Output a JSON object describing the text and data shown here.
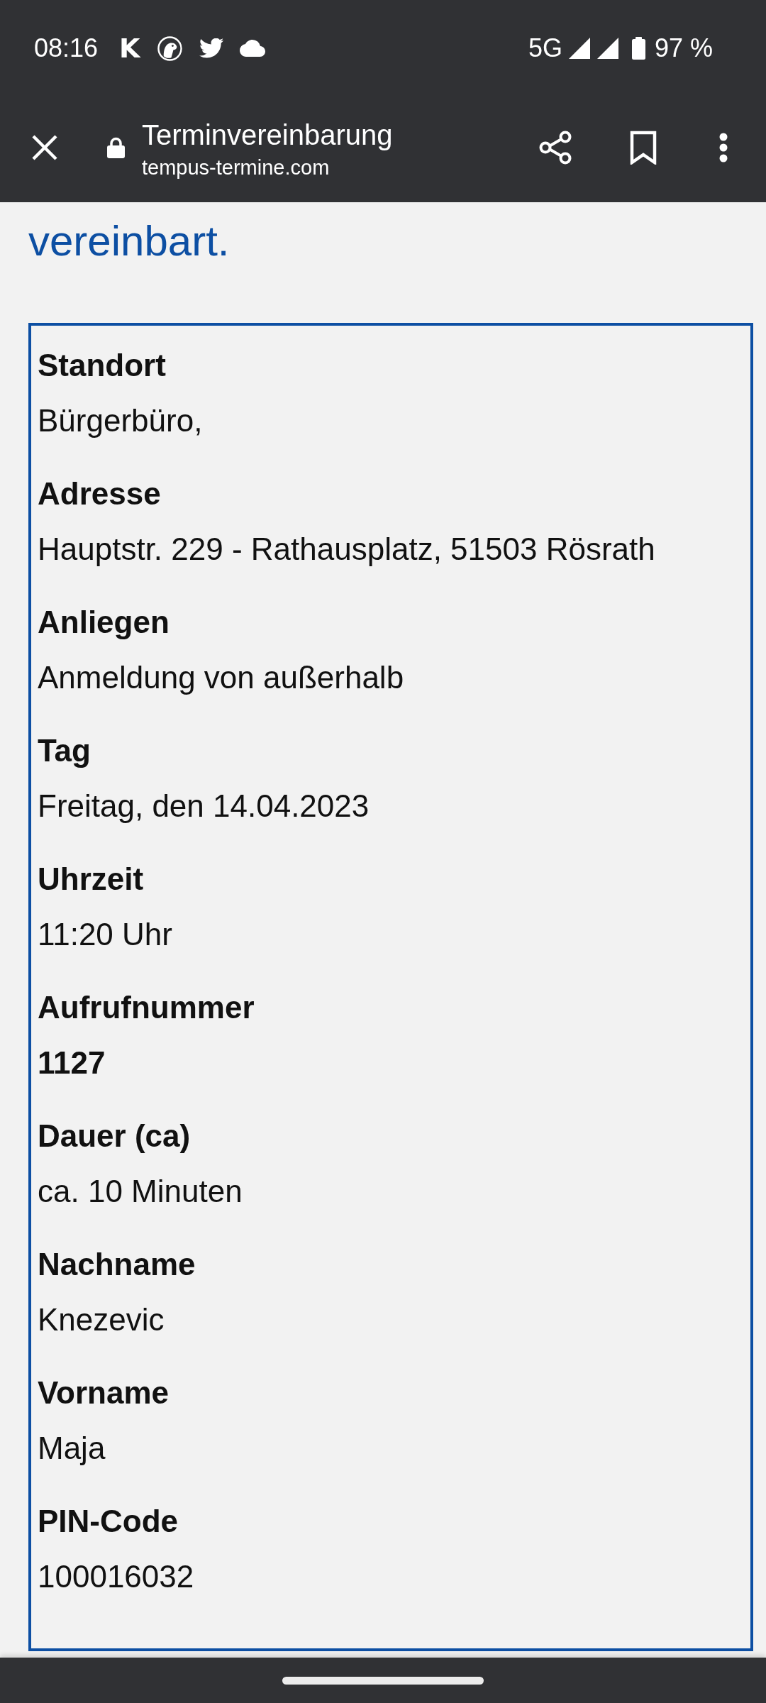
{
  "status_bar": {
    "time": "08:16",
    "app_letter": "K",
    "network": "5G",
    "battery": "97 %"
  },
  "toolbar": {
    "title": "Terminvereinbarung",
    "url": "tempus-termine.com"
  },
  "intro_text": "vereinbart.",
  "details": [
    {
      "label": "Standort",
      "value": "Bürgerbüro,",
      "value_bold": false
    },
    {
      "label": "Adresse",
      "value": "Hauptstr. 229 - Rathausplatz, 51503 Rösrath",
      "value_bold": false
    },
    {
      "label": "Anliegen",
      "value": "Anmeldung von außerhalb",
      "value_bold": false
    },
    {
      "label": "Tag",
      "value": "Freitag, den 14.04.2023",
      "value_bold": false
    },
    {
      "label": "Uhrzeit",
      "value": "11:20 Uhr",
      "value_bold": false
    },
    {
      "label": "Aufrufnummer",
      "value": "1127",
      "value_bold": true
    },
    {
      "label": "Dauer (ca)",
      "value": "ca. 10 Minuten",
      "value_bold": false
    },
    {
      "label": "Nachname",
      "value": "Knezevic",
      "value_bold": false
    },
    {
      "label": "Vorname",
      "value": "Maja",
      "value_bold": false
    },
    {
      "label": "PIN-Code",
      "value": "100016032",
      "value_bold": false
    }
  ]
}
